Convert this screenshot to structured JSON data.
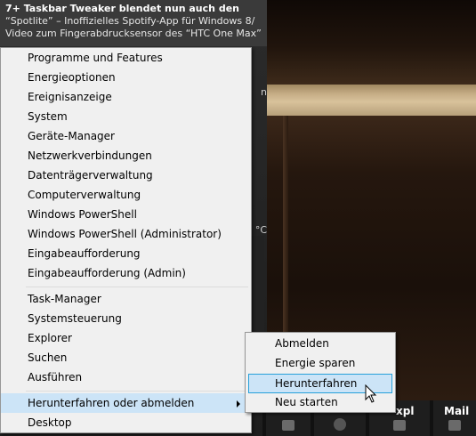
{
  "news": {
    "headline": "7+ Taskbar Tweaker blendet nun auch den",
    "line2": "“Spotlite” – Inoffizielles Spotify-App für Windows 8/",
    "line3": "Video zum Fingerabdrucksensor des “HTC One Max”"
  },
  "side_fragments": [
    "n",
    "°C"
  ],
  "menu": {
    "group1": [
      "Programme und Features",
      "Energieoptionen",
      "Ereignisanzeige",
      "System",
      "Geräte-Manager",
      "Netzwerkverbindungen",
      "Datenträgerverwaltung",
      "Computerverwaltung",
      "Windows PowerShell",
      "Windows PowerShell (Administrator)",
      "Eingabeaufforderung",
      "Eingabeaufforderung (Admin)"
    ],
    "group2": [
      "Task-Manager",
      "Systemsteuerung",
      "Explorer",
      "Suchen",
      "Ausführen"
    ],
    "group3": [
      "Herunterfahren oder abmelden",
      "Desktop"
    ]
  },
  "submenu": [
    "Abmelden",
    "Energie sparen",
    "Herunterfahren",
    "Neu starten"
  ],
  "taskbar": {
    "explorer_label": "xpl",
    "mail_label": "Mail"
  },
  "colors": {
    "highlight": "#cce4f7",
    "highlight_border": "#26a0da",
    "menu_bg": "#f0f0f0"
  }
}
